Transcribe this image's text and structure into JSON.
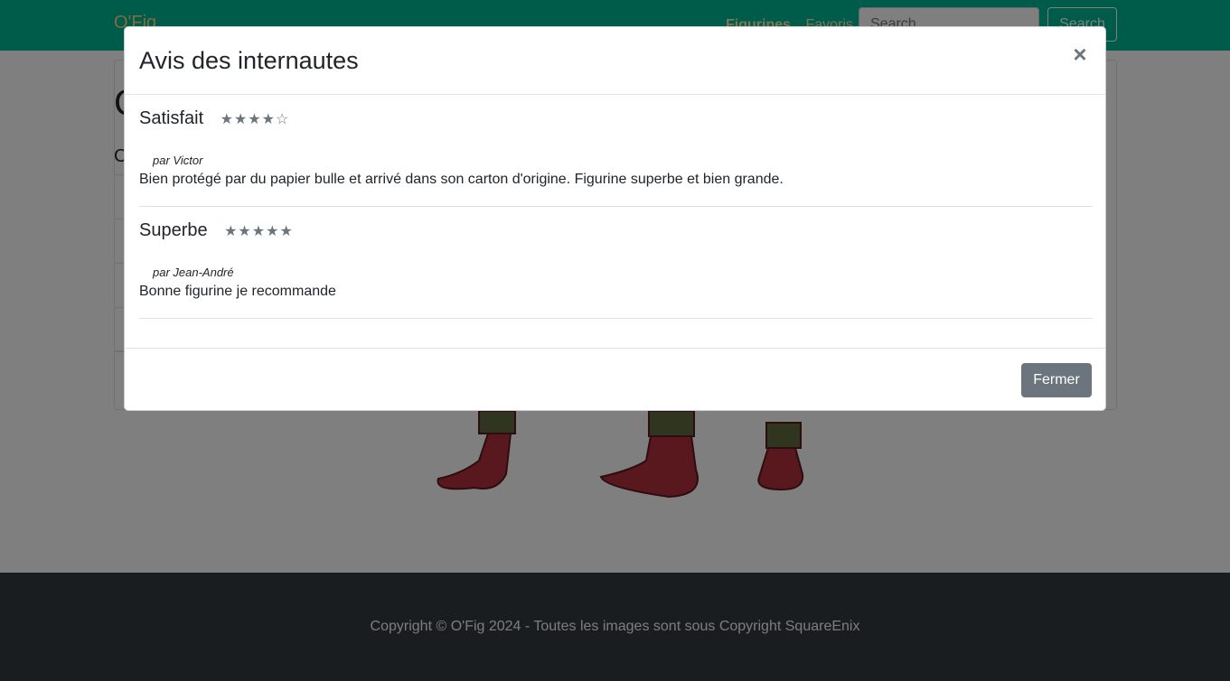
{
  "navbar": {
    "brand": "O'Fig",
    "links": [
      "Figurines",
      "Favoris"
    ],
    "search_placeholder": "Search",
    "search_button": "Search"
  },
  "page": {
    "heading": "C",
    "subheading": "C"
  },
  "footer": {
    "text": "Copyright © O'Fig 2024 - Toutes les images sont sous Copyright SquareEnix"
  },
  "modal": {
    "title": "Avis des internautes",
    "close_icon": "close-icon",
    "close_glyph": "×",
    "reviews": [
      {
        "title": "Satisfait",
        "rating": 4,
        "max_rating": 5,
        "stars": "★★★★☆",
        "author": "par Victor",
        "text": "Bien protégé par du papier bulle et arrivé dans son carton d'origine. Figurine superbe et bien grande."
      },
      {
        "title": "Superbe",
        "rating": 5,
        "max_rating": 5,
        "stars": "★★★★★",
        "author": "par Jean-André",
        "text": "Bonne figurine je recommande"
      }
    ],
    "footer_button": "Fermer"
  },
  "colors": {
    "navbar": "#00b894",
    "footer": "#343a40",
    "button_secondary": "#6c757d"
  }
}
